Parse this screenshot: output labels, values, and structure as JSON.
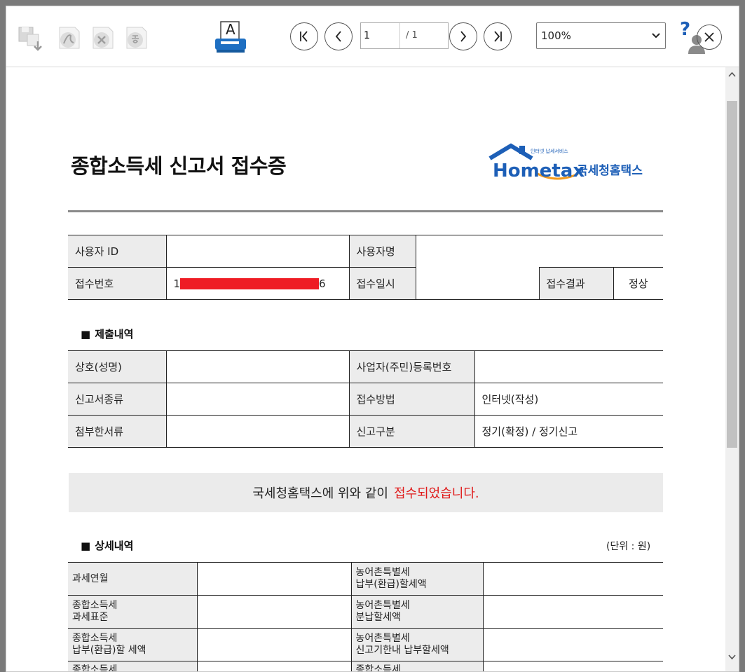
{
  "toolbar": {
    "icons": [
      "save-icon",
      "pdf-icon",
      "excel-icon",
      "hwp-icon",
      "print-icon"
    ],
    "print_letter": "A",
    "page_current": "1",
    "page_total": "/ 1",
    "zoom": "100%",
    "help": "?"
  },
  "document": {
    "title": "종합소득세 신고서 접수증",
    "logo": {
      "tagline": "인터넷 납세서비스",
      "brand": "Hometax",
      "suffix": "국세청홈택스"
    },
    "basic": {
      "user_id_label": "사용자 ID",
      "user_id_value": "",
      "user_name_label": "사용자명",
      "user_name_value": "",
      "receipt_no_label": "접수번호",
      "receipt_no_prefix": "1",
      "receipt_no_suffix": "6",
      "receipt_time_label": "접수일시",
      "receipt_time_value": "",
      "result_label": "접수결과",
      "result_value": "정상"
    },
    "submission": {
      "heading": "제출내역",
      "trade_name_label": "상호(성명)",
      "trade_name_value": "",
      "reg_no_label": "사업자(주민)등록번호",
      "reg_no_value": "",
      "form_type_label": "신고서종류",
      "form_type_value": "",
      "method_label": "접수방법",
      "method_value": "인터넷(작성)",
      "attachments_label": "첨부한서류",
      "attachments_value": "",
      "category_label": "신고구분",
      "category_value": "정기(확정) / 정기신고"
    },
    "notice": {
      "text": "국세청홈택스에 위와 같이",
      "highlight": "접수되었습니다."
    },
    "details": {
      "heading": "상세내역",
      "unit": "(단위 : 원)",
      "rows": [
        {
          "left_label": "과세연월",
          "left_value": "",
          "right_label_1": "농어촌특별세",
          "right_label_2": "납부(환급)할세액",
          "right_value": ""
        },
        {
          "left_label_1": "종합소득세",
          "left_label_2": "과세표준",
          "left_value": "",
          "right_label_1": "농어촌특별세",
          "right_label_2": "분납할세액",
          "right_value": ""
        },
        {
          "left_label_1": "종합소득세",
          "left_label_2": "납부(환급)할 세액",
          "left_value": "",
          "right_label_1": "농어촌특별세",
          "right_label_2": "신고기한내 납부할세액",
          "right_value": ""
        },
        {
          "left_label_1": "종합소득세",
          "left_value": "",
          "right_label_1": "종합소득세",
          "right_value": ""
        }
      ]
    }
  },
  "colors": {
    "accent_red": "#e01a1a",
    "label_bg": "#ececec",
    "logo_blue": "#1d5fb7",
    "logo_orange": "#f39a1e"
  }
}
